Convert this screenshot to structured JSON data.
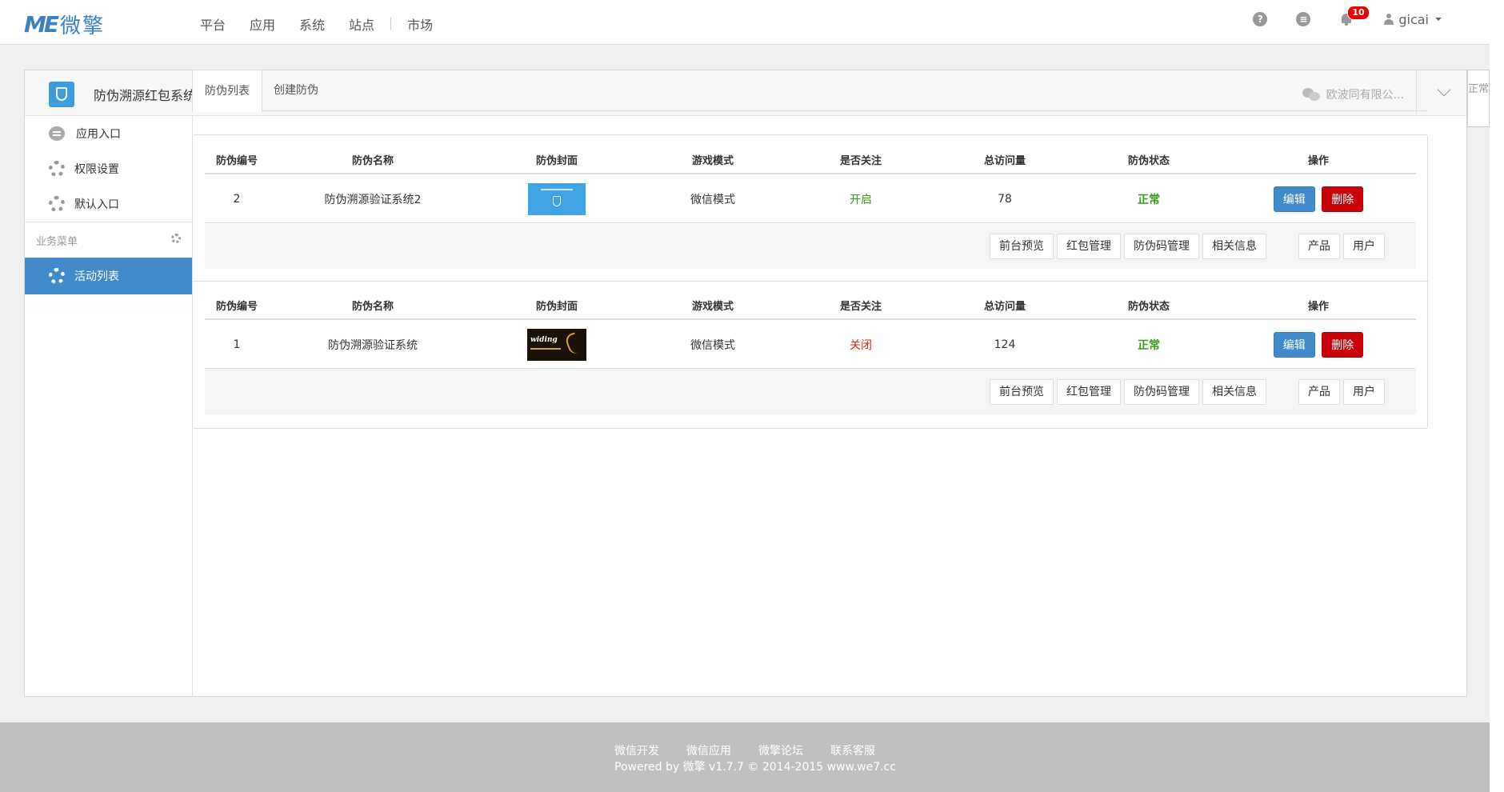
{
  "brand": {
    "mark": "ME",
    "name": "微擎"
  },
  "nav": [
    "平台",
    "应用",
    "系统",
    "站点",
    "市场"
  ],
  "topright": {
    "help": "?",
    "msg": "≡",
    "notif_count": "10",
    "username": "gicai"
  },
  "app": {
    "title": "防伪溯源红包系统",
    "account": "欧波同有限公..."
  },
  "sidebar": {
    "items": [
      {
        "label": "应用入口",
        "icon": "chat-icon"
      },
      {
        "label": "权限设置",
        "icon": "gear-icon"
      },
      {
        "label": "默认入口",
        "icon": "gear-icon"
      }
    ],
    "section": "业务菜单",
    "active": "活动列表"
  },
  "tabs": [
    "防伪列表",
    "创建防伪"
  ],
  "headers": [
    "防伪编号",
    "防伪名称",
    "防伪封面",
    "游戏模式",
    "是否关注",
    "总访问量",
    "防伪状态",
    "操作"
  ],
  "rows": [
    {
      "id": "2",
      "name": "防伪溯源验证系统2",
      "mode": "微信模式",
      "follow": "开启",
      "visits": "78",
      "status": "正常",
      "follow_color": "#3a9a1a"
    },
    {
      "id": "1",
      "name": "防伪溯源验证系统",
      "mode": "微信模式",
      "follow": "关闭",
      "visits": "124",
      "status": "正常",
      "follow_color": "#d9261c"
    }
  ],
  "cover2_text": "widing",
  "buttons": {
    "edit": "编辑",
    "delete": "删除"
  },
  "actions": [
    "前台预览",
    "红包管理",
    "防伪码管理",
    "相关信息"
  ],
  "actions2": [
    "产品",
    "用户"
  ],
  "right_tab": "正常",
  "footer": {
    "links": [
      "微信开发",
      "微信应用",
      "微擎论坛",
      "联系客服"
    ],
    "copyright": "Powered by 微擎 v1.7.7 © 2014-2015 www.we7.cc"
  }
}
